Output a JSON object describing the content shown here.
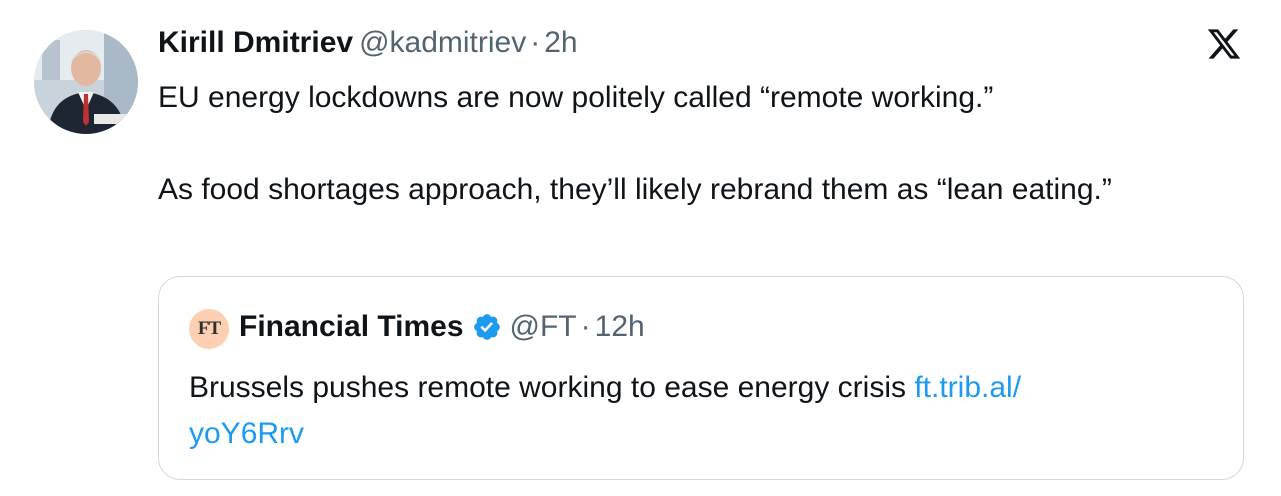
{
  "tweet": {
    "author_name": "Kirill Dmitriev",
    "author_handle": "@kadmitriev",
    "separator": "·",
    "time": "2h",
    "avatar_icon": "profile-photo",
    "platform_icon": "x-logo-icon",
    "text_line_1": "EU energy lockdowns are now politely called “remote working.”",
    "text_line_2": "As food shortages approach, they’ll likely rebrand them as “lean eating.”"
  },
  "quoted_tweet": {
    "avatar_text": "FT",
    "author_name": "Financial Times",
    "verified_icon": "verified-badge-icon",
    "author_handle": "@FT",
    "separator": "·",
    "time": "12h",
    "text": "Brussels pushes remote working to ease energy crisis ",
    "link_text_1": "ft.trib.al/",
    "link_text_2": "yoY6Rrv"
  },
  "colors": {
    "text": "#0f1419",
    "muted": "#536471",
    "link": "#1d9bf0",
    "border": "#cfd9de",
    "ft_avatar_bg": "#fcd0b1",
    "verified": "#1d9bf0"
  }
}
